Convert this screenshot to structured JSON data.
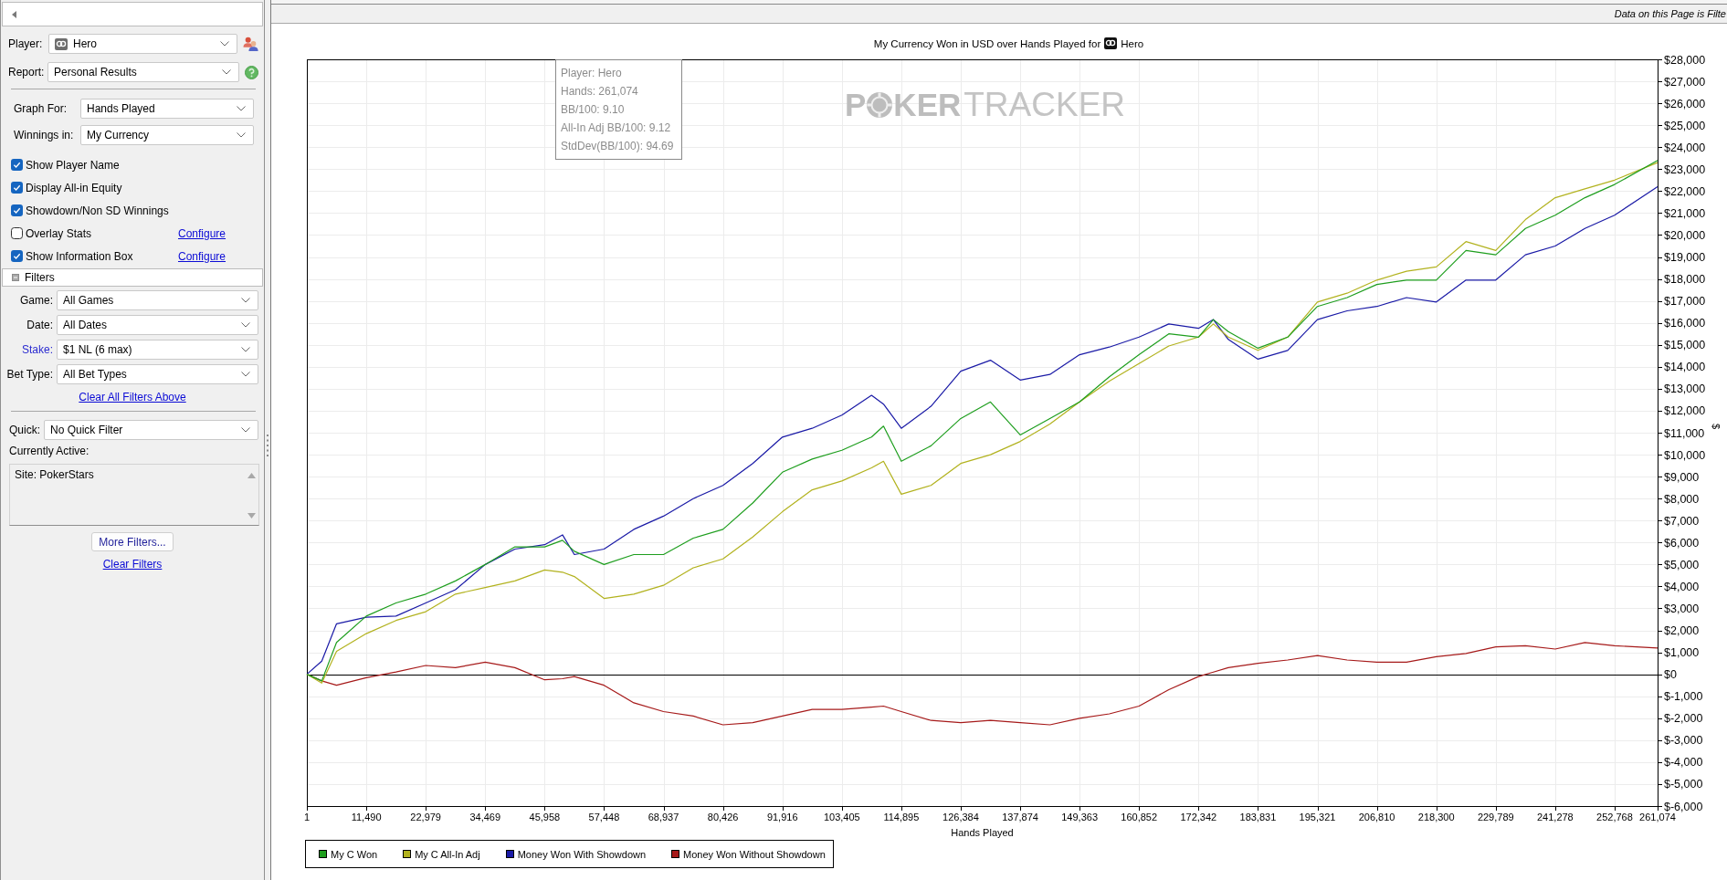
{
  "sidebar": {
    "player": {
      "label": "Player:",
      "value": "Hero"
    },
    "report": {
      "label": "Report:",
      "value": "Personal Results"
    },
    "graph_for": {
      "label": "Graph For:",
      "value": "Hands Played"
    },
    "winnings_in": {
      "label": "Winnings in:",
      "value": "My Currency"
    },
    "options": [
      {
        "label": "Show Player Name",
        "checked": true
      },
      {
        "label": "Display All-in Equity",
        "checked": true
      },
      {
        "label": "Showdown/Non SD Winnings",
        "checked": true
      },
      {
        "label": "Overlay Stats",
        "checked": false,
        "link": "Configure"
      },
      {
        "label": "Show Information Box",
        "checked": true,
        "link": "Configure"
      }
    ],
    "filters": {
      "title": "Filters",
      "expanded": true,
      "fields": [
        {
          "label": "Game:",
          "value": "All Games",
          "active": false
        },
        {
          "label": "Date:",
          "value": "All Dates",
          "active": false
        },
        {
          "label": "Stake:",
          "value": "$1 NL (6 max)",
          "active": true
        },
        {
          "label": "Bet Type:",
          "value": "All Bet Types",
          "active": false
        }
      ],
      "clear_link": "Clear All Filters Above"
    },
    "quick": {
      "label": "Quick:",
      "value": "No Quick Filter"
    },
    "currently_active": {
      "label": "Currently Active:",
      "items": [
        "Site: PokerStars"
      ]
    },
    "more_filters_button": "More Filters...",
    "clear_filters_link": "Clear Filters"
  },
  "graph": {
    "status_text": "Data on this Page is Filte",
    "title_player": "Hero",
    "info_box": [
      "Player: Hero",
      "Hands: 261,074",
      "BB/100: 9.10",
      "All-In Adj BB/100: 9.12",
      "StdDev(BB/100): 94.69"
    ],
    "watermark": {
      "first": "P",
      "middle": "KER",
      "last": "TRACKER"
    },
    "chart_data": {
      "type": "line",
      "title": "My Currency Won in USD over Hands Played for",
      "xlabel": "Hands Played",
      "ylabel": "$",
      "grid": true,
      "x": [
        1,
        2873,
        5746,
        11490,
        17235,
        22979,
        28724,
        34469,
        40214,
        45958,
        49405,
        51703,
        57448,
        63193,
        68937,
        74682,
        80426,
        86171,
        91916,
        97661,
        103405,
        109150,
        111448,
        114895,
        120640,
        126384,
        132129,
        137874,
        143619,
        149363,
        155108,
        160852,
        166597,
        172342,
        175214,
        178087,
        183831,
        189576,
        195321,
        201066,
        206810,
        212555,
        218300,
        224045,
        229789,
        235534,
        241278,
        247023,
        252768,
        261074
      ],
      "series": [
        {
          "name": "My C Won",
          "color": "#1e9e1e",
          "values": [
            0,
            -300,
            1450,
            2650,
            3250,
            3650,
            4250,
            5000,
            5800,
            5800,
            6100,
            5600,
            5000,
            5450,
            5450,
            6200,
            6600,
            7800,
            9200,
            9800,
            10200,
            10800,
            11300,
            9700,
            10400,
            11650,
            12400,
            10900,
            11650,
            12400,
            13550,
            14550,
            15500,
            15350,
            16150,
            15600,
            14850,
            15350,
            16750,
            17150,
            17750,
            17950,
            17950,
            19300,
            19100,
            20300,
            20900,
            21700,
            22300,
            23400
          ]
        },
        {
          "name": "My C All-In Adj",
          "color": "#b2b21e",
          "values": [
            0,
            -400,
            1050,
            1850,
            2450,
            2850,
            3650,
            3950,
            4250,
            4750,
            4650,
            4450,
            3450,
            3650,
            4050,
            4850,
            5250,
            6250,
            7400,
            8400,
            8800,
            9400,
            9700,
            8200,
            8600,
            9600,
            10000,
            10600,
            11400,
            12400,
            13350,
            14150,
            14950,
            15350,
            15950,
            15350,
            14750,
            15350,
            16950,
            17350,
            17950,
            18350,
            18550,
            19700,
            19300,
            20700,
            21700,
            22100,
            22500,
            23300
          ]
        },
        {
          "name": "Money Won With Showdown",
          "color": "#1a1aa6",
          "values": [
            0,
            600,
            2300,
            2600,
            2650,
            3250,
            3850,
            5000,
            5700,
            5900,
            6350,
            5450,
            5700,
            6600,
            7200,
            8000,
            8600,
            9600,
            10800,
            11200,
            11800,
            12700,
            12300,
            11200,
            12200,
            13800,
            14300,
            13400,
            13650,
            14550,
            14900,
            15350,
            15950,
            15750,
            16150,
            15250,
            14350,
            14750,
            16150,
            16550,
            16750,
            17150,
            16950,
            17950,
            17950,
            19100,
            19500,
            20300,
            20900,
            22200
          ]
        },
        {
          "name": "Money Won Without Showdown",
          "color": "#a61a1a",
          "values": [
            0,
            -300,
            -500,
            -150,
            100,
            400,
            300,
            550,
            300,
            -250,
            -200,
            -100,
            -500,
            -1300,
            -1700,
            -1900,
            -2300,
            -2200,
            -1900,
            -1600,
            -1600,
            -1500,
            -1450,
            -1700,
            -2100,
            -2200,
            -2100,
            -2200,
            -2300,
            -2000,
            -1800,
            -1450,
            -700,
            -100,
            100,
            300,
            500,
            650,
            850,
            650,
            550,
            550,
            800,
            950,
            1250,
            1300,
            1150,
            1450,
            1300,
            1200
          ]
        }
      ],
      "xlim": [
        1,
        261074
      ],
      "ylim": [
        -6000,
        28000
      ],
      "xticks": [
        {
          "value": 1,
          "label": "1"
        },
        {
          "value": 11490,
          "label": "11,490"
        },
        {
          "value": 22979,
          "label": "22,979"
        },
        {
          "value": 34469,
          "label": "34,469"
        },
        {
          "value": 45958,
          "label": "45,958"
        },
        {
          "value": 57448,
          "label": "57,448"
        },
        {
          "value": 68937,
          "label": "68,937"
        },
        {
          "value": 80426,
          "label": "80,426"
        },
        {
          "value": 91916,
          "label": "91,916"
        },
        {
          "value": 103405,
          "label": "103,405"
        },
        {
          "value": 114895,
          "label": "114,895"
        },
        {
          "value": 126384,
          "label": "126,384"
        },
        {
          "value": 137874,
          "label": "137,874"
        },
        {
          "value": 149363,
          "label": "149,363"
        },
        {
          "value": 160852,
          "label": "160,852"
        },
        {
          "value": 172342,
          "label": "172,342"
        },
        {
          "value": 183831,
          "label": "183,831"
        },
        {
          "value": 195321,
          "label": "195,321"
        },
        {
          "value": 206810,
          "label": "206,810"
        },
        {
          "value": 218300,
          "label": "218,300"
        },
        {
          "value": 229789,
          "label": "229,789"
        },
        {
          "value": 241278,
          "label": "241,278"
        },
        {
          "value": 252768,
          "label": "252,768"
        },
        {
          "value": 261074,
          "label": "261,074"
        }
      ],
      "yticks": [
        {
          "value": 28000,
          "label": "$28,000"
        },
        {
          "value": 27000,
          "label": "$27,000"
        },
        {
          "value": 26000,
          "label": "$26,000"
        },
        {
          "value": 25000,
          "label": "$25,000"
        },
        {
          "value": 24000,
          "label": "$24,000"
        },
        {
          "value": 23000,
          "label": "$23,000"
        },
        {
          "value": 22000,
          "label": "$22,000"
        },
        {
          "value": 21000,
          "label": "$21,000"
        },
        {
          "value": 20000,
          "label": "$20,000"
        },
        {
          "value": 19000,
          "label": "$19,000"
        },
        {
          "value": 18000,
          "label": "$18,000"
        },
        {
          "value": 17000,
          "label": "$17,000"
        },
        {
          "value": 16000,
          "label": "$16,000"
        },
        {
          "value": 15000,
          "label": "$15,000"
        },
        {
          "value": 14000,
          "label": "$14,000"
        },
        {
          "value": 13000,
          "label": "$13,000"
        },
        {
          "value": 12000,
          "label": "$12,000"
        },
        {
          "value": 11000,
          "label": "$11,000"
        },
        {
          "value": 10000,
          "label": "$10,000"
        },
        {
          "value": 9000,
          "label": "$9,000"
        },
        {
          "value": 8000,
          "label": "$8,000"
        },
        {
          "value": 7000,
          "label": "$7,000"
        },
        {
          "value": 6000,
          "label": "$6,000"
        },
        {
          "value": 5000,
          "label": "$5,000"
        },
        {
          "value": 4000,
          "label": "$4,000"
        },
        {
          "value": 3000,
          "label": "$3,000"
        },
        {
          "value": 2000,
          "label": "$2,000"
        },
        {
          "value": 1000,
          "label": "$1,000"
        },
        {
          "value": 0,
          "label": "$0"
        },
        {
          "value": -1000,
          "label": "$-1,000"
        },
        {
          "value": -2000,
          "label": "$-2,000"
        },
        {
          "value": -3000,
          "label": "$-3,000"
        },
        {
          "value": -4000,
          "label": "$-4,000"
        },
        {
          "value": -5000,
          "label": "$-5,000"
        },
        {
          "value": -6000,
          "label": "$-6,000"
        }
      ]
    }
  }
}
